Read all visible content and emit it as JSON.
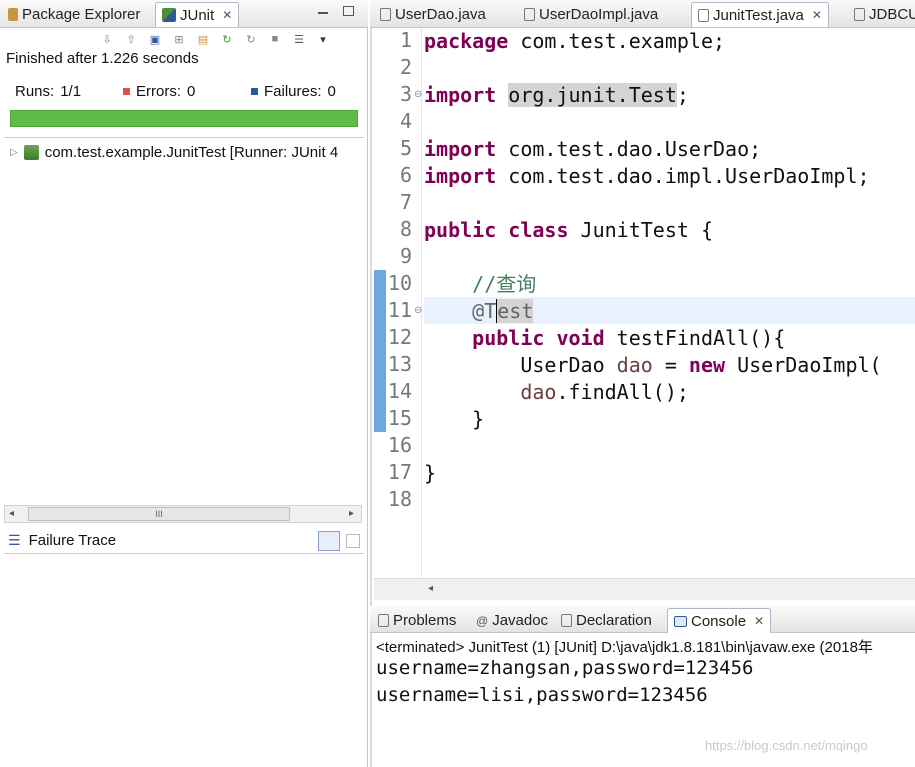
{
  "left_panel": {
    "tabs": [
      {
        "label": "Package Explorer",
        "icon": "package-explorer-icon"
      },
      {
        "label": "JUnit",
        "icon": "junit-icon",
        "active": true,
        "close": "✕"
      }
    ],
    "status": "Finished after 1.226 seconds",
    "runs_label": "Runs:",
    "runs_value": "1/1",
    "errors_label": "Errors:",
    "errors_value": "0",
    "failures_label": "Failures:",
    "failures_value": "0",
    "progress": 1.0,
    "progress_color": "#5dbb47",
    "tree_item": "com.test.example.JunitTest [Runner: JUnit 4",
    "failure_trace_label": "Failure Trace",
    "scroll_grip": "III"
  },
  "editor": {
    "tabs": [
      {
        "label": "UserDao.java"
      },
      {
        "label": "UserDaoImpl.java"
      },
      {
        "label": "JunitTest.java",
        "active": true,
        "close": "✕"
      },
      {
        "label": "JDBCU"
      }
    ],
    "line_numbers": [
      "1",
      "2",
      "3",
      "4",
      "5",
      "6",
      "7",
      "8",
      "9",
      "10",
      "11",
      "12",
      "13",
      "14",
      "15",
      "16",
      "17",
      "18"
    ]
  },
  "console": {
    "tabs": [
      {
        "label": "Problems"
      },
      {
        "label": "Javadoc"
      },
      {
        "label": "Declaration"
      },
      {
        "label": "Console",
        "active": true,
        "close": "✕"
      }
    ],
    "status": "<terminated> JunitTest (1) [JUnit] D:\\java\\jdk1.8.181\\bin\\javaw.exe (2018年",
    "output": [
      "username=zhangsan,password=123456",
      "username=lisi,password=123456"
    ]
  },
  "watermark": "https://blog.csdn.net/mqingo",
  "colors": {
    "keyword": "#7f0055",
    "comment": "#3f7f5f",
    "highlight_line": "#e8f2fe"
  }
}
